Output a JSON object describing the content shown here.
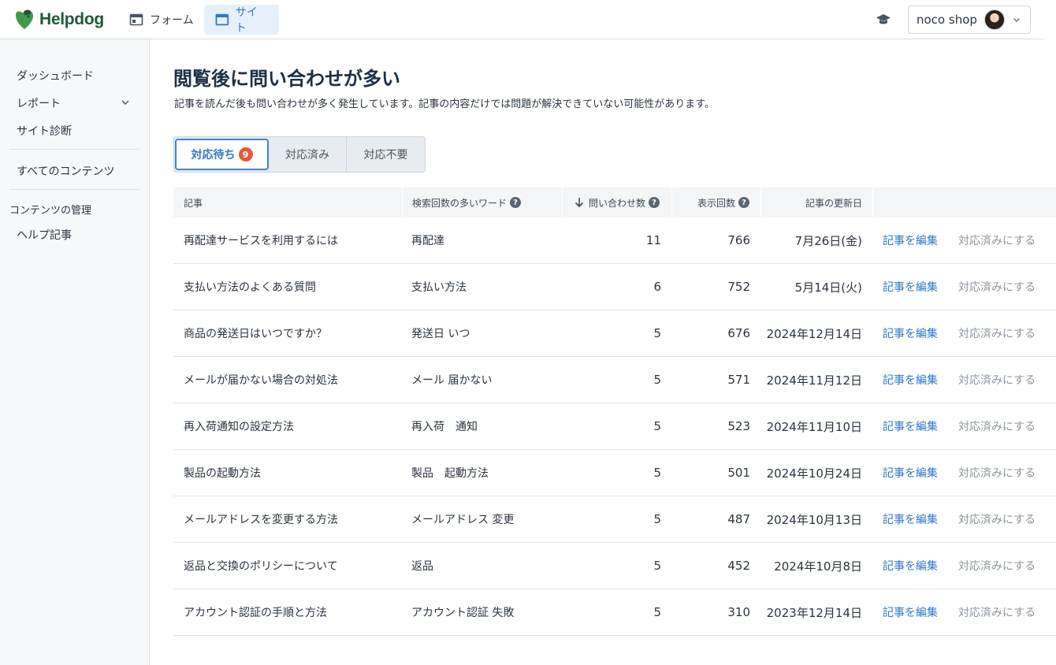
{
  "header": {
    "brand": "Helpdog",
    "nav": [
      {
        "label": "フォーム",
        "icon": "form-icon"
      },
      {
        "label": "サイト",
        "icon": "browser-window-icon"
      }
    ],
    "shop_name": "noco shop"
  },
  "sidebar": {
    "items": [
      "ダッシュボード",
      "レポート",
      "サイト診断"
    ],
    "all_contents": "すべてのコンテンツ",
    "section_title": "コンテンツの管理",
    "help_articles": "ヘルプ記事"
  },
  "page": {
    "title": "閲覧後に問い合わせが多い",
    "subtitle": "記事を読んだ後も問い合わせが多く発生しています。記事の内容だけでは問題が解決できていない可能性があります。"
  },
  "tabs": {
    "pending": "対応待ち",
    "pending_count": "9",
    "done": "対応済み",
    "unneeded": "対応不要"
  },
  "table": {
    "headers": {
      "article": "記事",
      "keywords": "検索回数の多いワード",
      "inquiries": "問い合わせ数",
      "views": "表示回数",
      "updated": "記事の更新日"
    },
    "edit_label": "記事を編集",
    "resolve_label": "対応済みにする",
    "rows": [
      {
        "title": "再配達サービスを利用するには",
        "keywords": "再配達",
        "inquiries": "11",
        "views": "766",
        "updated": "7月26日(金)"
      },
      {
        "title": "支払い方法のよくある質問",
        "keywords": "支払い方法",
        "inquiries": "6",
        "views": "752",
        "updated": "5月14日(火)"
      },
      {
        "title": "商品の発送日はいつですか？",
        "keywords": "発送日 いつ",
        "inquiries": "5",
        "views": "676",
        "updated": "2024年12月14日"
      },
      {
        "title": "メールが届かない場合の対処法",
        "keywords": "メール 届かない",
        "inquiries": "5",
        "views": "571",
        "updated": "2024年11月12日"
      },
      {
        "title": "再入荷通知の設定方法",
        "keywords": "再入荷　通知",
        "inquiries": "5",
        "views": "523",
        "updated": "2024年11月10日"
      },
      {
        "title": "製品の起動方法",
        "keywords": "製品　起動方法",
        "inquiries": "5",
        "views": "501",
        "updated": "2024年10月24日"
      },
      {
        "title": "メールアドレスを変更する方法",
        "keywords": "メールアドレス 変更",
        "inquiries": "5",
        "views": "487",
        "updated": "2024年10月13日"
      },
      {
        "title": "返品と交換のポリシーについて",
        "keywords": "返品",
        "inquiries": "5",
        "views": "452",
        "updated": "2024年10月8日"
      },
      {
        "title": "アカウント認証の手順と方法",
        "keywords": "アカウント認証 失敗",
        "inquiries": "5",
        "views": "310",
        "updated": "2023年12月14日"
      }
    ]
  },
  "colors": {
    "accent": "#2f78c9",
    "brand_green": "#1e5a3a",
    "badge": "#e35a38"
  }
}
